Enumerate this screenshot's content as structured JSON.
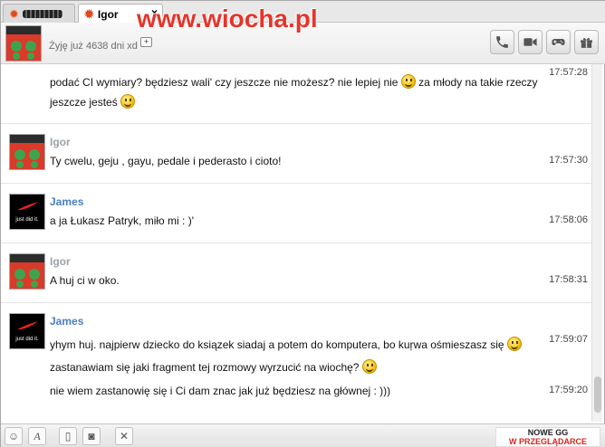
{
  "watermark": "www.wiocha.pl",
  "tabs": [
    {
      "label": "",
      "active": false
    },
    {
      "label": "Igor",
      "active": true
    }
  ],
  "header": {
    "status": "Żyję już 4638 dni xd",
    "actions": [
      "phone-icon",
      "video-camera-icon",
      "gamepad-icon",
      "gift-icon"
    ]
  },
  "messages": [
    {
      "sender": "",
      "sender_type": "igor",
      "lines": [
        {
          "text": "podać CI wymiary? będziesz wali' czy jeszcze nie możesz? nie lepiej nie",
          "tail": "za młody na takie rzeczy",
          "time": "17:57:28"
        },
        {
          "text": "jeszcze jesteś",
          "tail": "",
          "time": ""
        }
      ]
    },
    {
      "sender": "Igor",
      "sender_type": "igor",
      "lines": [
        {
          "text": "Ty cwelu, geju , gayu, pedale i pederasto i cioto!",
          "tail": "",
          "time": "17:57:30"
        }
      ]
    },
    {
      "sender": "James",
      "sender_type": "james",
      "lines": [
        {
          "text": "a ja Łukasz Patryk, miło mi : )'",
          "tail": "",
          "time": "17:58:06"
        }
      ]
    },
    {
      "sender": "Igor",
      "sender_type": "igor",
      "lines": [
        {
          "text": "A huj ci w oko.",
          "tail": "",
          "time": "17:58:31"
        }
      ]
    },
    {
      "sender": "James",
      "sender_type": "james",
      "lines": [
        {
          "text": "yhym huj. najpierw dziecko do ksiązek siadaj a potem do komputera, bo kuŗwa ośmieszasz się",
          "tail": "",
          "time": "17:59:07"
        },
        {
          "text": "zastanawiam się jaki fragment tej rozmowy wyrzucić na wiochę?",
          "tail": "",
          "time": ""
        },
        {
          "text": "nie wiem zastanowię się i Ci dam znac jak już będziesz na głównej : )))",
          "tail": "",
          "time": "17:59:20"
        }
      ]
    }
  ],
  "avatar_text": {
    "james": "just did it."
  },
  "promo": {
    "line1": "NOWE GG",
    "line2": "W PRZEGLĄDARCE"
  },
  "colors": {
    "igor_name": "#9aa2a8",
    "james_name": "#4a7fc2",
    "watermark": "#e5352b"
  }
}
